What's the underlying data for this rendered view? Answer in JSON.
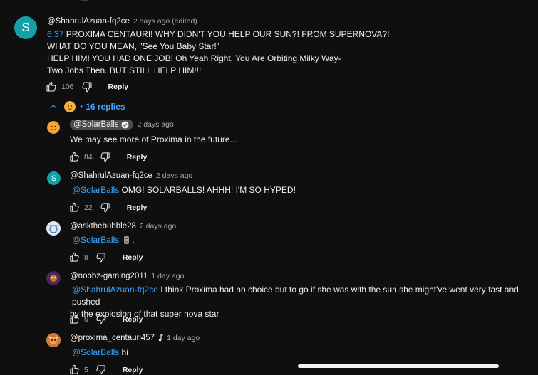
{
  "colors": {
    "background": "#0f0f0f",
    "text": "#f1f1f1",
    "secondary": "#aaaaaa",
    "link": "#3ea6ff",
    "avatar_teal": "#159fa6"
  },
  "main_comment": {
    "avatar_letter": "S",
    "author": "@ShahrulAzuan-fq2ce",
    "time": "2 days ago (edited)",
    "timestamp_link": "6:37",
    "line1": " PROXIMA CENTAURI! WHY DIDN'T YOU HELP OUR SUN?! FROM SUPERNOVA?!",
    "line2": "WHAT DO YOU MEAN, \"See You Baby Star!\"",
    "line3": "HELP HIM! YOU HAD ONE JOB! Oh Yeah Right, You Are Orbiting Milky Way-",
    "line4": "Two Jobs Then. BUT STILL HELP HIM!!!",
    "likes": "106",
    "reply_label": "Reply"
  },
  "replies_toggle": {
    "label": "16 replies"
  },
  "replies": [
    {
      "author": "@SolarBalls",
      "time": "2 days ago",
      "mention": "",
      "text": "We may see more of Proxima in the future...",
      "likes": "84",
      "reply_label": "Reply"
    },
    {
      "avatar_letter": "S",
      "author": "@ShahrulAzuan-fq2ce",
      "time": "2 days ago",
      "mention": "@SolarBalls",
      "text": " OMG! SOLARBALLS! AHHH! I'M SO HYPED!",
      "likes": "22",
      "reply_label": "Reply"
    },
    {
      "author": "@askthebubble28",
      "time": "2 days ago",
      "mention": "@SolarBalls",
      "text": ".",
      "likes": "8",
      "reply_label": "Reply"
    },
    {
      "author": "@noobz-gaming2011",
      "time": "1 day ago",
      "mention": "@ShahrulAzuan-fq2ce",
      "text_line1": " I think Proxima had no choice but to go if she was with the sun she might've went very fast and pushed",
      "text_line2": "by the explosion of that super nova star",
      "likes": "6",
      "reply_label": "Reply"
    },
    {
      "author": "@proxima_centauri457",
      "time": "1 day ago",
      "mention": "@SolarBalls",
      "text": " hi",
      "likes": "5",
      "reply_label": "Reply"
    }
  ]
}
